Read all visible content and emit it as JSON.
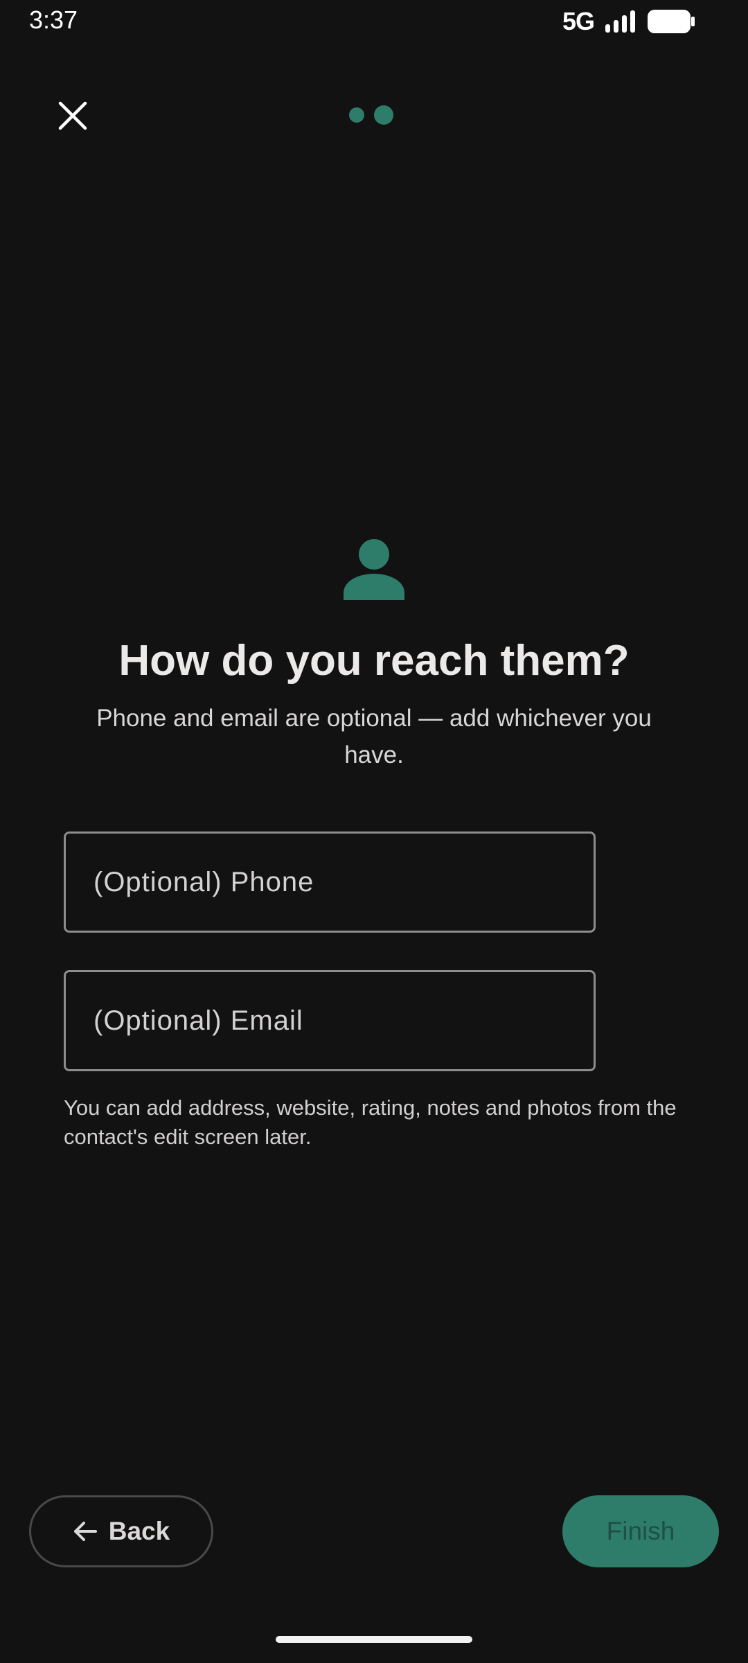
{
  "status_bar": {
    "time": "3:37",
    "network": "5G",
    "signal_icon": "signal-bars-icon",
    "battery_icon": "battery-full-icon"
  },
  "top_bar": {
    "close_icon": "close-icon",
    "progress": {
      "total_steps": 2,
      "current_step": 2
    }
  },
  "content": {
    "avatar_icon": "person-icon",
    "heading": "How do you reach them?",
    "subheading": "Phone and email are optional — add whichever you have.",
    "phone_field": {
      "placeholder": "(Optional) Phone",
      "value": ""
    },
    "email_field": {
      "placeholder": "(Optional) Email",
      "value": ""
    },
    "helper": "You can add address, website, rating, notes and photos from the contact's edit screen later."
  },
  "buttons": {
    "back_label": "Back",
    "back_icon": "arrow-left-icon",
    "finish_label": "Finish"
  },
  "colors": {
    "background": "#121212",
    "accent": "#2e7d6b",
    "finish_text": "#1f4f45"
  }
}
